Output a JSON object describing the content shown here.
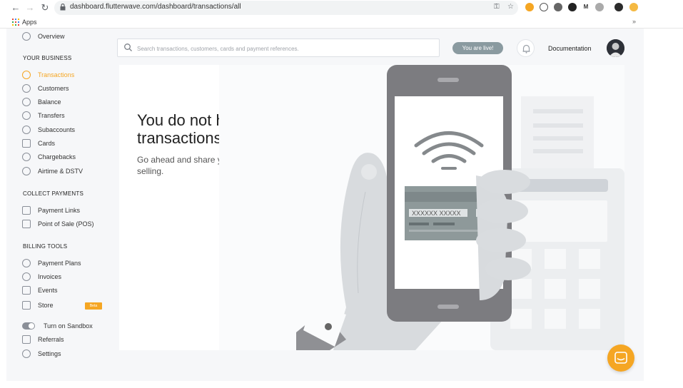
{
  "browser": {
    "url": "dashboard.flutterwave.com/dashboard/transactions/all",
    "bookmarks_label": "Apps",
    "bookmarks_more": "»"
  },
  "sidebar": {
    "overview": "Overview",
    "your_business_heading": "YOUR BUSINESS",
    "business_items": [
      {
        "label": "Transactions",
        "icon": "lightning-icon",
        "active": true
      },
      {
        "label": "Customers",
        "icon": "customers-icon"
      },
      {
        "label": "Balance",
        "icon": "balance-icon"
      },
      {
        "label": "Transfers",
        "icon": "transfers-icon"
      },
      {
        "label": "Subaccounts",
        "icon": "subaccounts-icon"
      },
      {
        "label": "Cards",
        "icon": "cards-icon"
      },
      {
        "label": "Chargebacks",
        "icon": "chargebacks-icon"
      },
      {
        "label": "Airtime & DSTV",
        "icon": "airtime-icon"
      }
    ],
    "collect_payments_heading": "COLLECT PAYMENTS",
    "collect_items": [
      {
        "label": "Payment Links",
        "icon": "link-icon"
      },
      {
        "label": "Point of Sale (POS)",
        "icon": "pos-icon"
      }
    ],
    "billing_tools_heading": "BILLING TOOLS",
    "billing_items": [
      {
        "label": "Payment Plans",
        "icon": "payment-plans-icon"
      },
      {
        "label": "Invoices",
        "icon": "invoices-icon"
      },
      {
        "label": "Events",
        "icon": "events-icon"
      },
      {
        "label": "Store",
        "icon": "store-icon"
      }
    ],
    "store_badge": "Beta",
    "bottom_items": [
      {
        "label": "Turn on Sandbox",
        "icon": "toggle-icon"
      },
      {
        "label": "Referrals",
        "icon": "referrals-icon"
      },
      {
        "label": "Settings",
        "icon": "gear-icon"
      }
    ]
  },
  "topbar": {
    "search_placeholder": "Search transactions, customers, cards and payment references.",
    "live_badge": "You are live!",
    "documentation": "Documentation"
  },
  "empty_state": {
    "heading": "You do not have any transactions yet.",
    "subtext": "Go ahead and share your payment pages and start selling.",
    "card_number": "XXXXXX XXXXX"
  },
  "colors": {
    "accent": "#f5a623",
    "sidebar_bg": "#f6f7f9",
    "illustration_gray": "#7c7c80"
  }
}
